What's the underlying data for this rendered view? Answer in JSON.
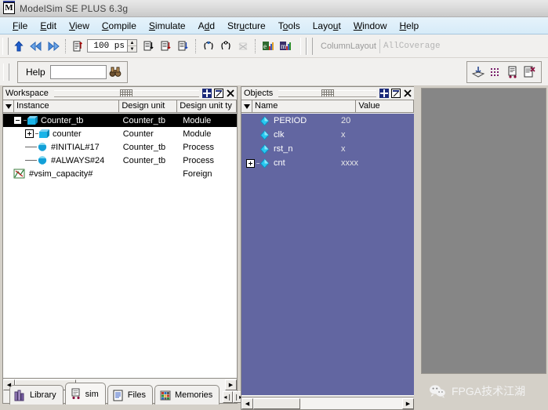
{
  "window": {
    "title": "ModelSim SE PLUS 6.3g",
    "app_icon": "modelsim-m-icon"
  },
  "menubar": {
    "items": [
      {
        "label": "File",
        "mnemonic": "F"
      },
      {
        "label": "Edit",
        "mnemonic": "E"
      },
      {
        "label": "View",
        "mnemonic": "V"
      },
      {
        "label": "Compile",
        "mnemonic": "C"
      },
      {
        "label": "Simulate",
        "mnemonic": "S"
      },
      {
        "label": "Add",
        "mnemonic": "d"
      },
      {
        "label": "Structure",
        "mnemonic": "u"
      },
      {
        "label": "Tools",
        "mnemonic": "o"
      },
      {
        "label": "Layout",
        "mnemonic": "u"
      },
      {
        "label": "Window",
        "mnemonic": "W"
      },
      {
        "label": "Help",
        "mnemonic": "H"
      }
    ]
  },
  "toolbar": {
    "run_time_value": "100 ps",
    "column_layout_label": "ColumnLayout",
    "column_layout_value": "AllCoverage",
    "buttons": [
      "run-up-icon",
      "step-back-icon",
      "step-forward-icon",
      "restart-icon",
      "run-icon",
      "continue-run-icon",
      "run-all-icon",
      "break-icon",
      "step-icon",
      "step-over-icon",
      "coverage-report-icon",
      "memory-icon"
    ]
  },
  "help_toolbar": {
    "label": "Help",
    "input_value": "",
    "search_icon": "binoculars-icon",
    "right_buttons": [
      "download-icon",
      "grid-icon",
      "profile-icon",
      "report-icon"
    ]
  },
  "workspace": {
    "title": "Workspace",
    "title_buttons": [
      "undock-icon",
      "maximize-icon",
      "close-icon"
    ],
    "columns": [
      "Instance",
      "Design unit",
      "Design unit ty"
    ],
    "rows": [
      {
        "instance": "Counter_tb",
        "design_unit": "Counter_tb",
        "design_unit_type": "Module",
        "depth": 0,
        "expander": "minus",
        "icon": "module-icon",
        "selected": true
      },
      {
        "instance": "counter",
        "design_unit": "Counter",
        "design_unit_type": "Module",
        "depth": 1,
        "expander": "plus",
        "icon": "module-icon",
        "selected": false
      },
      {
        "instance": "#INITIAL#17",
        "design_unit": "Counter_tb",
        "design_unit_type": "Process",
        "depth": 1,
        "expander": "none",
        "icon": "process-icon",
        "selected": false
      },
      {
        "instance": "#ALWAYS#24",
        "design_unit": "Counter_tb",
        "design_unit_type": "Process",
        "depth": 1,
        "expander": "none",
        "icon": "process-icon",
        "selected": false
      },
      {
        "instance": "#vsim_capacity#",
        "design_unit": "",
        "design_unit_type": "Foreign",
        "depth": 0,
        "expander": "none",
        "icon": "foreign-icon",
        "selected": false
      }
    ]
  },
  "objects": {
    "title": "Objects",
    "title_buttons": [
      "undock-icon",
      "maximize-icon",
      "close-icon"
    ],
    "columns": [
      "Name",
      "Value"
    ],
    "rows": [
      {
        "name": "PERIOD",
        "value": "20",
        "expander": "none",
        "icon": "signal-icon"
      },
      {
        "name": "clk",
        "value": "x",
        "expander": "none",
        "icon": "signal-icon"
      },
      {
        "name": "rst_n",
        "value": "x",
        "expander": "none",
        "icon": "signal-icon"
      },
      {
        "name": "cnt",
        "value": "xxxx",
        "expander": "plus",
        "icon": "signal-icon"
      }
    ]
  },
  "tabs": {
    "items": [
      {
        "label": "Library",
        "icon": "library-icon",
        "active": false
      },
      {
        "label": "sim",
        "icon": "sim-icon",
        "active": true
      },
      {
        "label": "Files",
        "icon": "files-icon",
        "active": false
      },
      {
        "label": "Memories",
        "icon": "memories-icon",
        "active": false
      }
    ],
    "nav_prev": "◂❘",
    "nav_next": "❘▸"
  },
  "watermark": {
    "text": "FPGA技术江湖",
    "icon": "wechat-icon"
  },
  "colors": {
    "objects_bg": "#6266a1",
    "menubar_bg": "#d9ecf8",
    "toolbar_bg": "#f1f0ee",
    "right_pane_bg": "#868686",
    "selection_bg": "#000000",
    "chrome_bg": "#d4d0c8"
  }
}
